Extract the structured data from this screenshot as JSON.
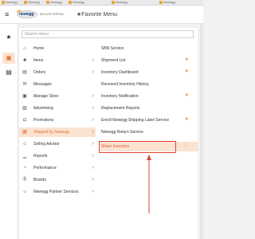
{
  "bookmarks": [
    {
      "label": "Newegg"
    },
    {
      "label": "Newegg"
    },
    {
      "label": "Newegg"
    },
    {
      "label": "Newegg"
    },
    {
      "label": "Newegg"
    },
    {
      "label": "Newegg"
    }
  ],
  "header": {
    "logo_text": "newegg",
    "portal_label": "SELLER PORTAL",
    "favorite_menu_label": "★Favorite Menu"
  },
  "search": {
    "placeholder": "Search menu"
  },
  "menu": [
    {
      "label": "Home",
      "icon": "home-icon",
      "glyph": "⌂",
      "has_chevron": false
    },
    {
      "label": "Items",
      "icon": "items-icon",
      "glyph": "■",
      "has_chevron": true
    },
    {
      "label": "Orders",
      "icon": "orders-icon",
      "glyph": "▤",
      "has_chevron": true
    },
    {
      "label": "Messages",
      "icon": "messages-icon",
      "glyph": "✉",
      "has_chevron": false
    },
    {
      "label": "Manage Store",
      "icon": "store-icon",
      "glyph": "▣",
      "has_chevron": true
    },
    {
      "label": "Advertising",
      "icon": "advertising-icon",
      "glyph": "▧",
      "has_chevron": true
    },
    {
      "label": "Promotions",
      "icon": "promotions-icon",
      "glyph": "◘",
      "has_chevron": true
    },
    {
      "label": "Shipped by Newegg",
      "icon": "shipped-icon",
      "glyph": "▦",
      "has_chevron": true,
      "selected": true
    },
    {
      "label": "Selling Advisor",
      "icon": "advisor-icon",
      "glyph": "☺",
      "has_chevron": true
    },
    {
      "label": "Reports",
      "icon": "reports-icon",
      "glyph": "▁",
      "has_chevron": true
    },
    {
      "label": "Performance",
      "icon": "performance-icon",
      "glyph": "◔",
      "has_chevron": true
    },
    {
      "label": "Brands",
      "icon": "brands-icon",
      "glyph": "Ⓑ",
      "has_chevron": true
    },
    {
      "label": "Newegg Partner Services",
      "icon": "partner-icon",
      "glyph": "☼",
      "has_chevron": true
    }
  ],
  "submenu": [
    {
      "label": "SBN Service",
      "favorite": "none"
    },
    {
      "label": "Shipment List",
      "favorite": "filled"
    },
    {
      "label": "Inventory Dashboard",
      "favorite": "filled"
    },
    {
      "label": "Received Inventory History",
      "favorite": "none"
    },
    {
      "label": "Inventory Notification",
      "favorite": "filled"
    },
    {
      "label": "Replacement Reports",
      "favorite": "none"
    },
    {
      "label": "Enroll Newegg Shipping Label Service",
      "favorite": "filled"
    },
    {
      "label": "Newegg Return Service",
      "favorite": "none"
    },
    {
      "label": "Share Inventory",
      "favorite": "outline",
      "highlighted": true
    }
  ],
  "colors": {
    "accent": "#ef8a3d",
    "selected_bg": "#fbe3d2",
    "annotation_red": "#e0453a",
    "logo_blue": "#0c3a7a"
  }
}
